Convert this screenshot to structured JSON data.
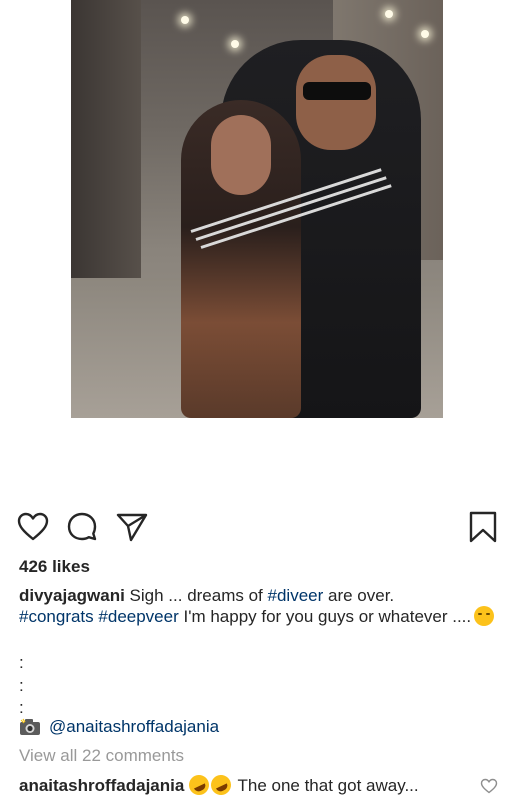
{
  "post": {
    "image_alt": "photo-of-two-people-hugging",
    "likes": "426 likes",
    "caption": {
      "username": "divyajagwani",
      "text_1": " Sigh ... dreams of ",
      "hashtag_1": "#diveer",
      "text_2": " are over.",
      "hashtag_2": "#congrats",
      "text_3": " ",
      "hashtag_3": "#deepveer",
      "text_4": " I'm happy for you guys or whatever ....",
      "dots": [
        ":",
        ":",
        ":"
      ],
      "mention": "@anaitashroffadajania"
    },
    "view_all_comments": "View all 22 comments",
    "comment": {
      "username": "anaitashroffadajania",
      "text": " The one that got away..."
    }
  },
  "icons": {
    "like": "heart-icon",
    "comment": "comment-icon",
    "share": "paper-plane-icon",
    "save": "bookmark-icon",
    "camera": "camera-emoji-icon"
  },
  "colors": {
    "text": "#262626",
    "hashtag": "#003569",
    "muted": "#999999"
  }
}
